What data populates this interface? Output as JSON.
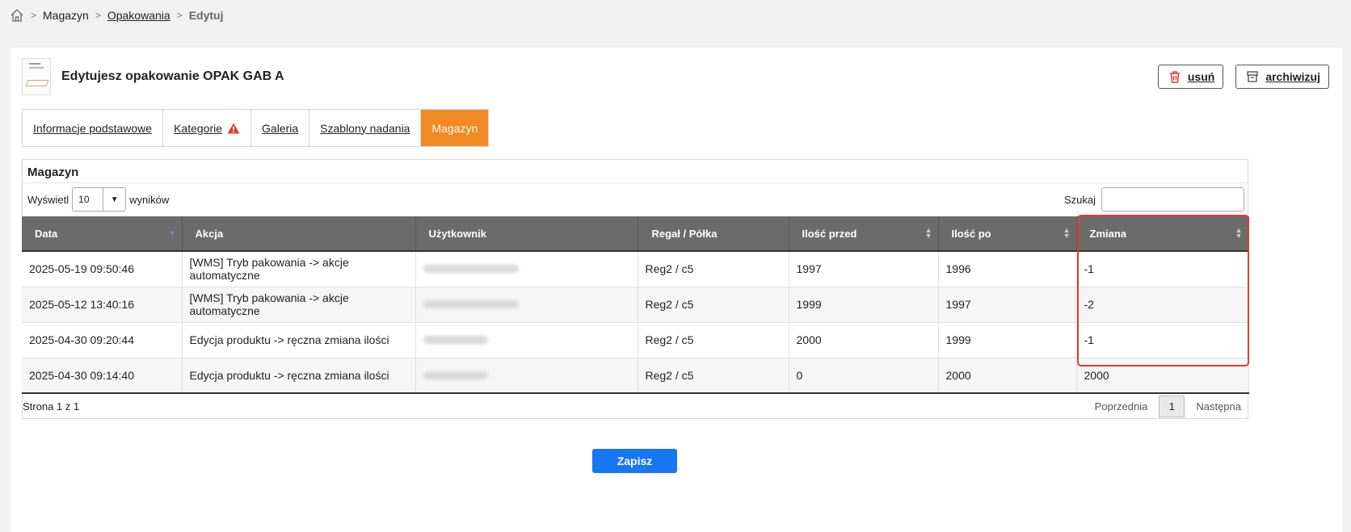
{
  "breadcrumb": {
    "items": [
      "Magazyn",
      "Opakowania",
      "Edytuj"
    ]
  },
  "header": {
    "title": "Edytujesz opakowanie OPAK GAB A",
    "delete_label": "usuń",
    "archive_label": "archiwizuj"
  },
  "tabs": [
    {
      "label": "Informacje podstawowe"
    },
    {
      "label": "Kategorie"
    },
    {
      "label": "Galeria"
    },
    {
      "label": "Szablony nadania"
    },
    {
      "label": "Magazyn"
    }
  ],
  "panel": {
    "title": "Magazyn",
    "show_prefix": "Wyświetl",
    "page_size": "10",
    "show_suffix": "wyników",
    "search_label": "Szukaj",
    "search_value": ""
  },
  "table": {
    "columns": [
      "Data",
      "Akcja",
      "Użytkownik",
      "Regał / Półka",
      "Ilość przed",
      "Ilość po",
      "Zmiana"
    ],
    "rows": [
      {
        "date": "2025-05-19 09:50:46",
        "action": "[WMS] Tryb pakowania -> akcje automatyczne",
        "location": "Reg2 / c5",
        "before": "1997",
        "after": "1996",
        "change": "-1"
      },
      {
        "date": "2025-05-12 13:40:16",
        "action": "[WMS] Tryb pakowania -> akcje automatyczne",
        "location": "Reg2 / c5",
        "before": "1999",
        "after": "1997",
        "change": "-2"
      },
      {
        "date": "2025-04-30 09:20:44",
        "action": "Edycja produktu -> ręczna zmiana ilości",
        "location": "Reg2 / c5",
        "before": "2000",
        "after": "1999",
        "change": "-1"
      },
      {
        "date": "2025-04-30 09:14:40",
        "action": "Edycja produktu -> ręczna zmiana ilości",
        "location": "Reg2 / c5",
        "before": "0",
        "after": "2000",
        "change": "2000"
      }
    ]
  },
  "footer": {
    "info": "Strona 1 z 1",
    "prev": "Poprzednia",
    "page": "1",
    "next": "Następna"
  },
  "save_label": "Zapisz",
  "colors": {
    "accent_tab": "#f08a24",
    "save_button": "#1877f2",
    "highlight": "#e53935",
    "table_header": "#6b6b6b"
  }
}
